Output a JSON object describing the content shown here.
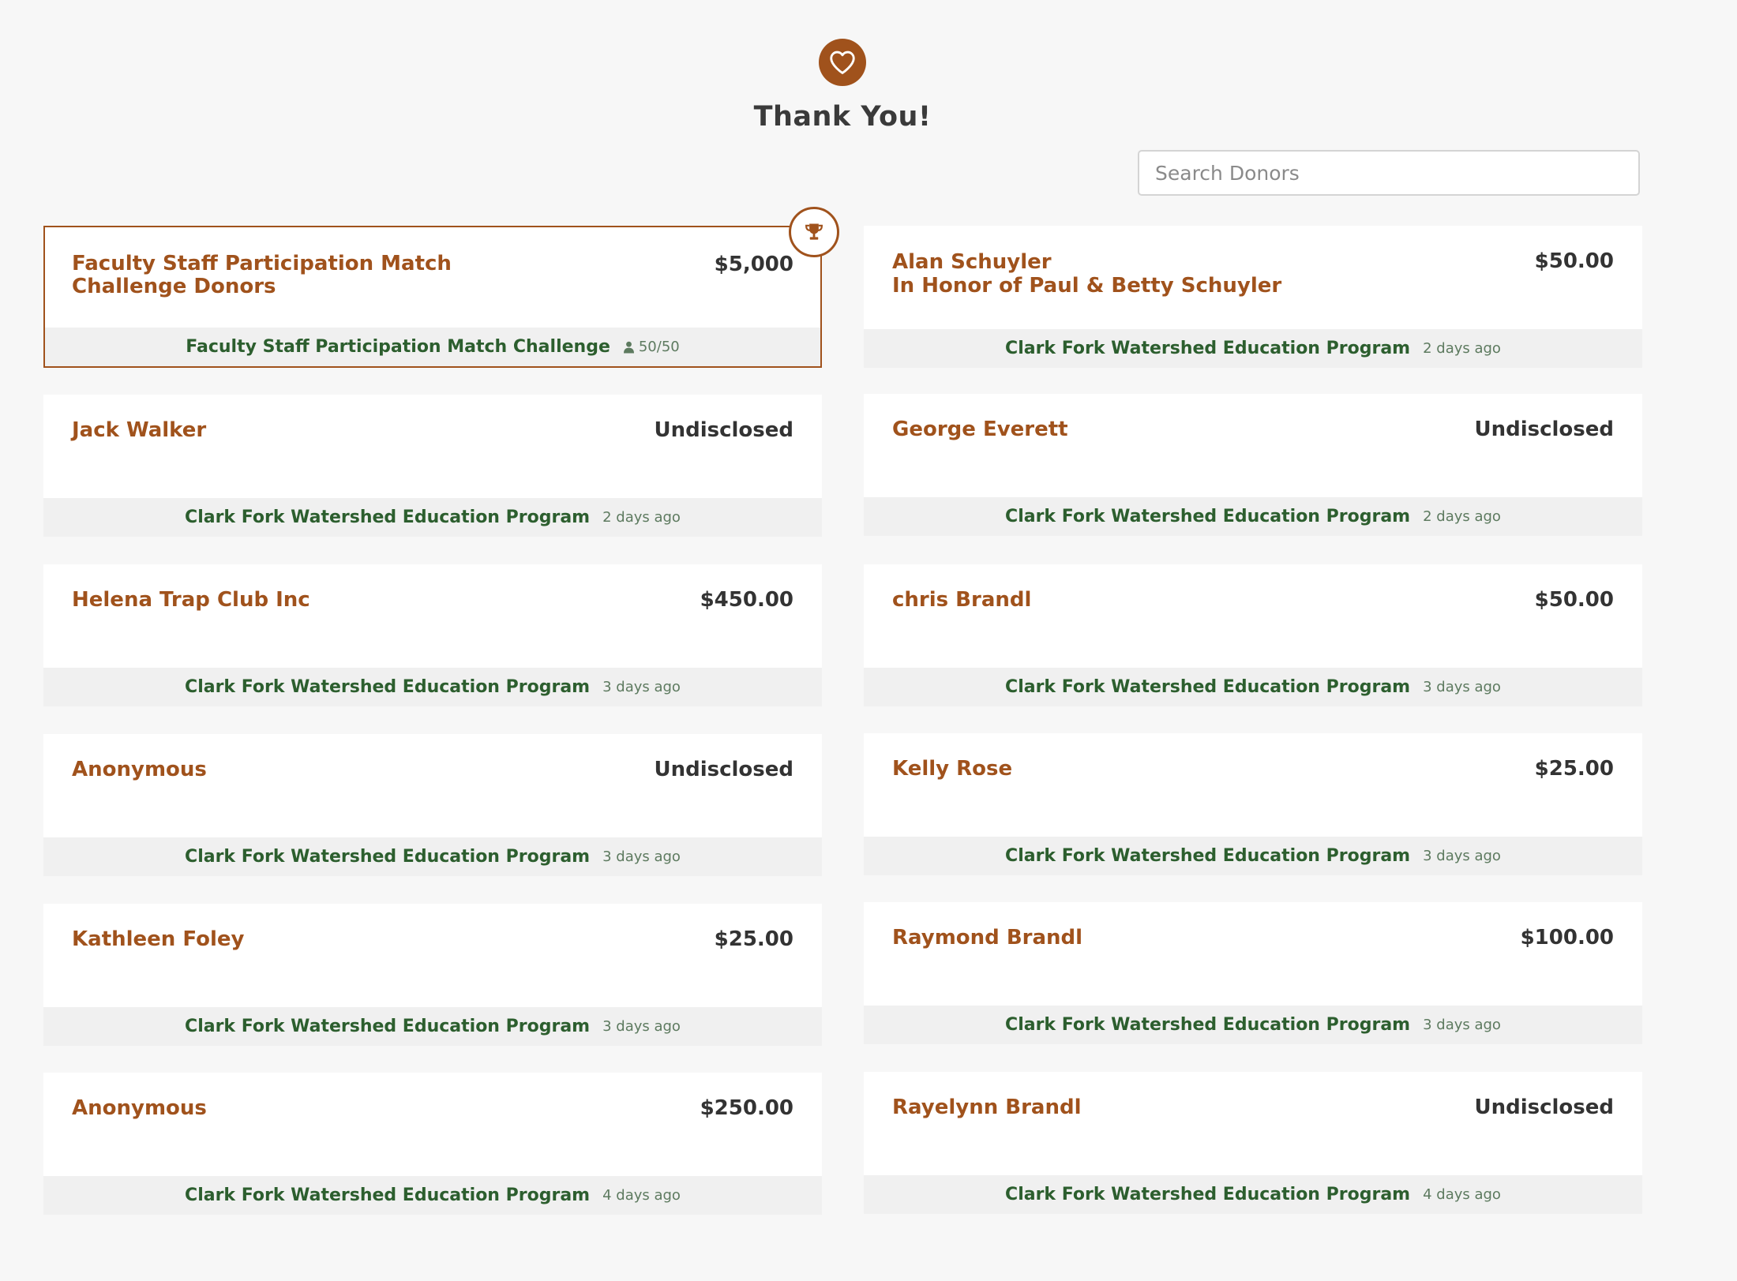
{
  "header": {
    "icon": "heart-icon",
    "title": "Thank You!"
  },
  "search": {
    "placeholder": "Search Donors",
    "value": ""
  },
  "colors": {
    "accent": "#a0521c",
    "program": "#2c5e2e",
    "background": "#f7f7f7"
  },
  "featured": {
    "name": "Faculty Staff Participation Match Challenge Donors",
    "amount": "$5,000",
    "program": "Faculty Staff Participation Match Challenge",
    "count": "50/50",
    "badge_icon": "trophy-icon"
  },
  "donations": [
    {
      "name": "Alan Schuyler",
      "subtitle": "In Honor of Paul & Betty Schuyler",
      "amount": "$50.00",
      "program": "Clark Fork Watershed Education Program",
      "time": "2 days ago"
    },
    {
      "name": "Jack Walker",
      "amount": "Undisclosed",
      "program": "Clark Fork Watershed Education Program",
      "time": "2 days ago"
    },
    {
      "name": "George Everett",
      "amount": "Undisclosed",
      "program": "Clark Fork Watershed Education Program",
      "time": "2 days ago"
    },
    {
      "name": "Helena Trap Club Inc",
      "amount": "$450.00",
      "program": "Clark Fork Watershed Education Program",
      "time": "3 days ago"
    },
    {
      "name": "chris Brandl",
      "amount": "$50.00",
      "program": "Clark Fork Watershed Education Program",
      "time": "3 days ago"
    },
    {
      "name": "Anonymous",
      "amount": "Undisclosed",
      "program": "Clark Fork Watershed Education Program",
      "time": "3 days ago"
    },
    {
      "name": "Kelly Rose",
      "amount": "$25.00",
      "program": "Clark Fork Watershed Education Program",
      "time": "3 days ago"
    },
    {
      "name": "Kathleen Foley",
      "amount": "$25.00",
      "program": "Clark Fork Watershed Education Program",
      "time": "3 days ago"
    },
    {
      "name": "Raymond Brandl",
      "amount": "$100.00",
      "program": "Clark Fork Watershed Education Program",
      "time": "3 days ago"
    },
    {
      "name": "Anonymous",
      "amount": "$250.00",
      "program": "Clark Fork Watershed Education Program",
      "time": "4 days ago"
    },
    {
      "name": "Rayelynn Brandl",
      "amount": "Undisclosed",
      "program": "Clark Fork Watershed Education Program",
      "time": "4 days ago"
    }
  ]
}
